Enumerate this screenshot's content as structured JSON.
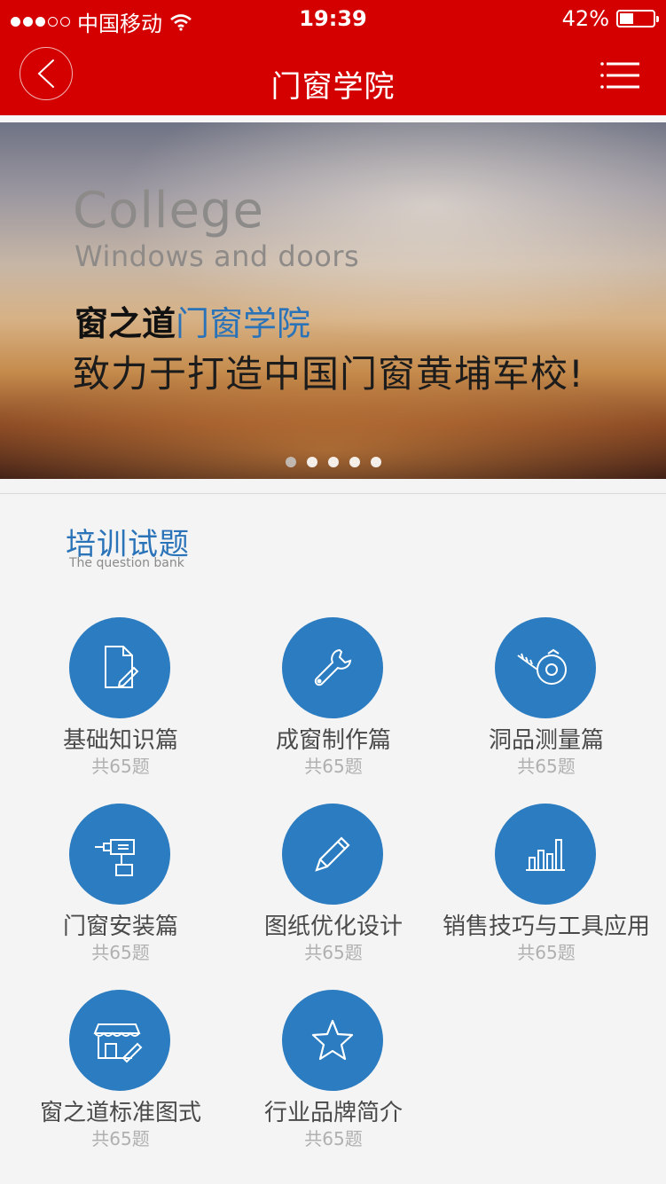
{
  "status_bar": {
    "carrier": "中国移动",
    "time": "19:39",
    "battery_text": "42%",
    "battery_level": 0.42,
    "signal_bars": 3
  },
  "nav": {
    "title": "门窗学院",
    "back_icon": "chevron-left-icon",
    "menu_icon": "menu-icon"
  },
  "banner": {
    "en_title": "College",
    "en_subtitle": "Windows and doors",
    "brand": "窗之道",
    "brand_college": "门窗学院",
    "slogan": "致力于打造中国门窗黄埔军校!",
    "slide_count": 5,
    "active_slide": 0
  },
  "section": {
    "title": "培训试题",
    "subtitle": "The question bank"
  },
  "categories": [
    {
      "label": "基础知识篇",
      "count": "共65题",
      "icon": "document-edit-icon"
    },
    {
      "label": "成窗制作篇",
      "count": "共65题",
      "icon": "wrench-icon"
    },
    {
      "label": "洞品测量篇",
      "count": "共65题",
      "icon": "tape-measure-icon"
    },
    {
      "label": "门窗安装篇",
      "count": "共65题",
      "icon": "drill-icon"
    },
    {
      "label": "图纸优化设计",
      "count": "共65题",
      "icon": "pencil-icon"
    },
    {
      "label": "销售技巧与工具应用",
      "count": "共65题",
      "icon": "bar-chart-icon"
    },
    {
      "label": "窗之道标准图式",
      "count": "共65题",
      "icon": "storefront-icon"
    },
    {
      "label": "行业品牌简介",
      "count": "共65题",
      "icon": "star-icon"
    }
  ],
  "colors": {
    "brand_red": "#d40000",
    "accent_blue": "#2b7cc0"
  }
}
